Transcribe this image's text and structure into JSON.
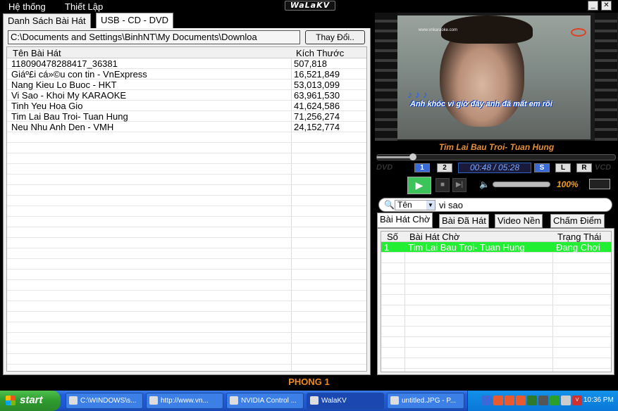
{
  "menu": {
    "system": "Hệ thống",
    "settings": "Thiết Lập"
  },
  "app_logo": "WaLaKV",
  "window_buttons": {
    "minimize": "_",
    "close": "✕"
  },
  "left_tabs": {
    "song_list": "Danh Sách Bài Hát",
    "usb": "USB - CD - DVD"
  },
  "path": {
    "value": "C:\\Documents  and  Settings\\BinhNT\\My Documents\\Downloa",
    "change_label": "Thay Đổi.."
  },
  "song_table": {
    "headers": {
      "name": "Tên Bài Hát",
      "size": "Kích Thước"
    },
    "rows": [
      {
        "name": "118090478288417_36381",
        "size": "507,818"
      },
      {
        "name": "Giáº£i cá»©u con tin - VnExpress",
        "size": "16,521,849"
      },
      {
        "name": "Nang Kieu Lo Buoc - HKT",
        "size": "53,013,099"
      },
      {
        "name": "Vi Sao - Khoi My KARAOKE",
        "size": "63,961,530"
      },
      {
        "name": "Tinh Yeu Hoa Gio",
        "size": "41,624,586"
      },
      {
        "name": "Tim Lai Bau Troi- Tuan Hung",
        "size": "71,256,274"
      },
      {
        "name": "Neu Nhu Anh Den - VMH",
        "size": "24,152,774"
      }
    ]
  },
  "video": {
    "watermark": "www.vnkaraoke.com",
    "notes": "♪ ♪ ♪",
    "lyric": "Anh khóc vì giờ đây anh đã mất em rồi"
  },
  "now_playing": "Tim Lai Bau Troi- Tuan Hung",
  "seek_progress": 0.15,
  "player": {
    "dvd_left": "DVD",
    "dvd_right": "VCD",
    "btn1": "1",
    "btn2": "2",
    "time": "00:48 / 05:28",
    "btn_s": "S",
    "btn_l": "L",
    "btn_r": "R",
    "volume_pct": "100%",
    "volume_level": 1.0
  },
  "search": {
    "type": "Tên",
    "text": "vi sao"
  },
  "right_tabs": {
    "waiting": "Bài Hát Chờ",
    "sung": "Bài Đã Hát",
    "video": "Video Nền",
    "score": "Chấm Điểm"
  },
  "queue": {
    "headers": {
      "no": "Số",
      "song": "Bài Hát Chờ",
      "status": "Trạng Thái"
    },
    "rows": [
      {
        "no": "1",
        "song": "Tim Lai Bau Troi- Tuan Hung",
        "status": "Đang Chơi"
      }
    ]
  },
  "room": "PHONG 1",
  "taskbar": {
    "start": "start",
    "tasks": [
      {
        "label": "C:\\WINDOWS\\s..."
      },
      {
        "label": "http://www.vn..."
      },
      {
        "label": "NVIDIA Control ..."
      },
      {
        "label": "WalaKV"
      },
      {
        "label": "untitled.JPG - P..."
      }
    ],
    "clock": "10:36 PM"
  },
  "colors": {
    "accent_orange": "#f08a20",
    "playing_green": "#22ee33",
    "play_button": "#3cc35a"
  }
}
